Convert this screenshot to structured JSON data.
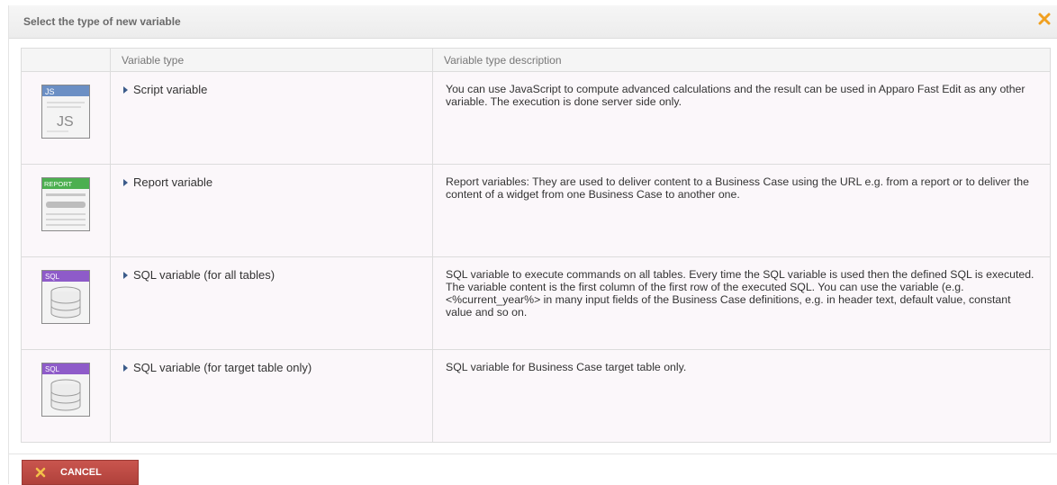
{
  "dialog": {
    "title": "Select the type of new variable"
  },
  "table": {
    "headers": [
      "",
      "Variable type",
      "Variable type description"
    ],
    "rows": [
      {
        "icon": "js-script-icon",
        "icon_label": "JS",
        "name": "Script variable",
        "description": "You can use JavaScript to compute advanced calculations and the result can be used in Apparo Fast Edit as any other variable. The execution is done server side only."
      },
      {
        "icon": "report-icon",
        "icon_label": "REPORT",
        "name": "Report variable",
        "description": "Report variables: They are used to deliver content to a Business Case using the URL e.g. from a report or to deliver the content of a widget from one Business Case to another one."
      },
      {
        "icon": "sql-database-icon",
        "icon_label": "SQL",
        "name": "SQL variable (for all tables)",
        "description": "SQL variable to execute commands on all tables. Every time the SQL variable is used then the defined SQL is executed. The variable content is the first column of the first row of the executed SQL. You can use the variable (e.g. <%current_year%> in many input fields of the Business Case definitions, e.g. in header text, default value, constant value and so on."
      },
      {
        "icon": "sql-database-icon",
        "icon_label": "SQL",
        "name": "SQL variable (for target table only)",
        "description": "SQL variable for Business Case target table only."
      }
    ]
  },
  "footer": {
    "cancel_label": "CANCEL"
  },
  "colors": {
    "accent_close": "#f0a020",
    "cancel_bg": "#b84843",
    "js_header": "#6b8fc4",
    "report_header": "#4caf50",
    "sql_header": "#8e5bc9"
  }
}
